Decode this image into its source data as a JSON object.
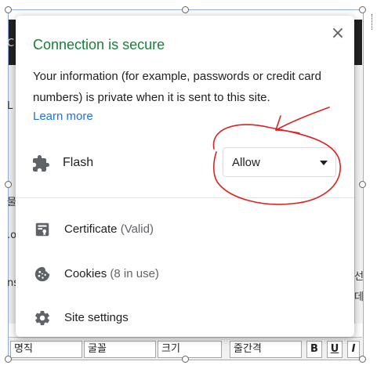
{
  "popup": {
    "title": "Connection is secure",
    "description": "Your information (for example, passwords or credit card numbers) is private when it is sent to this site.",
    "learn_more": "Learn more",
    "close_symbol": "×",
    "permission": {
      "label": "Flash",
      "icon": "puzzle-piece-icon",
      "value": "Allow"
    },
    "items": [
      {
        "label": "Certificate",
        "sub": "(Valid)",
        "icon": "certificate-icon"
      },
      {
        "label": "Cookies",
        "sub": "(8 in use)",
        "icon": "cookie-icon"
      },
      {
        "label": "Site settings",
        "sub": "",
        "icon": "gear-icon"
      }
    ],
    "colors": {
      "title": "#188038",
      "link": "#1a73e8",
      "annotation": "#e0201e"
    }
  },
  "background": {
    "left_chars": [
      "C",
      "L",
      "물",
      ".o",
      "ns"
    ],
    "right_chars": [
      "선",
      "데"
    ],
    "toolbar": {
      "items": [
        "명직",
        "굴꼴",
        "크기",
        "줄간격"
      ],
      "buttons": [
        "B",
        "U",
        "I"
      ]
    }
  }
}
